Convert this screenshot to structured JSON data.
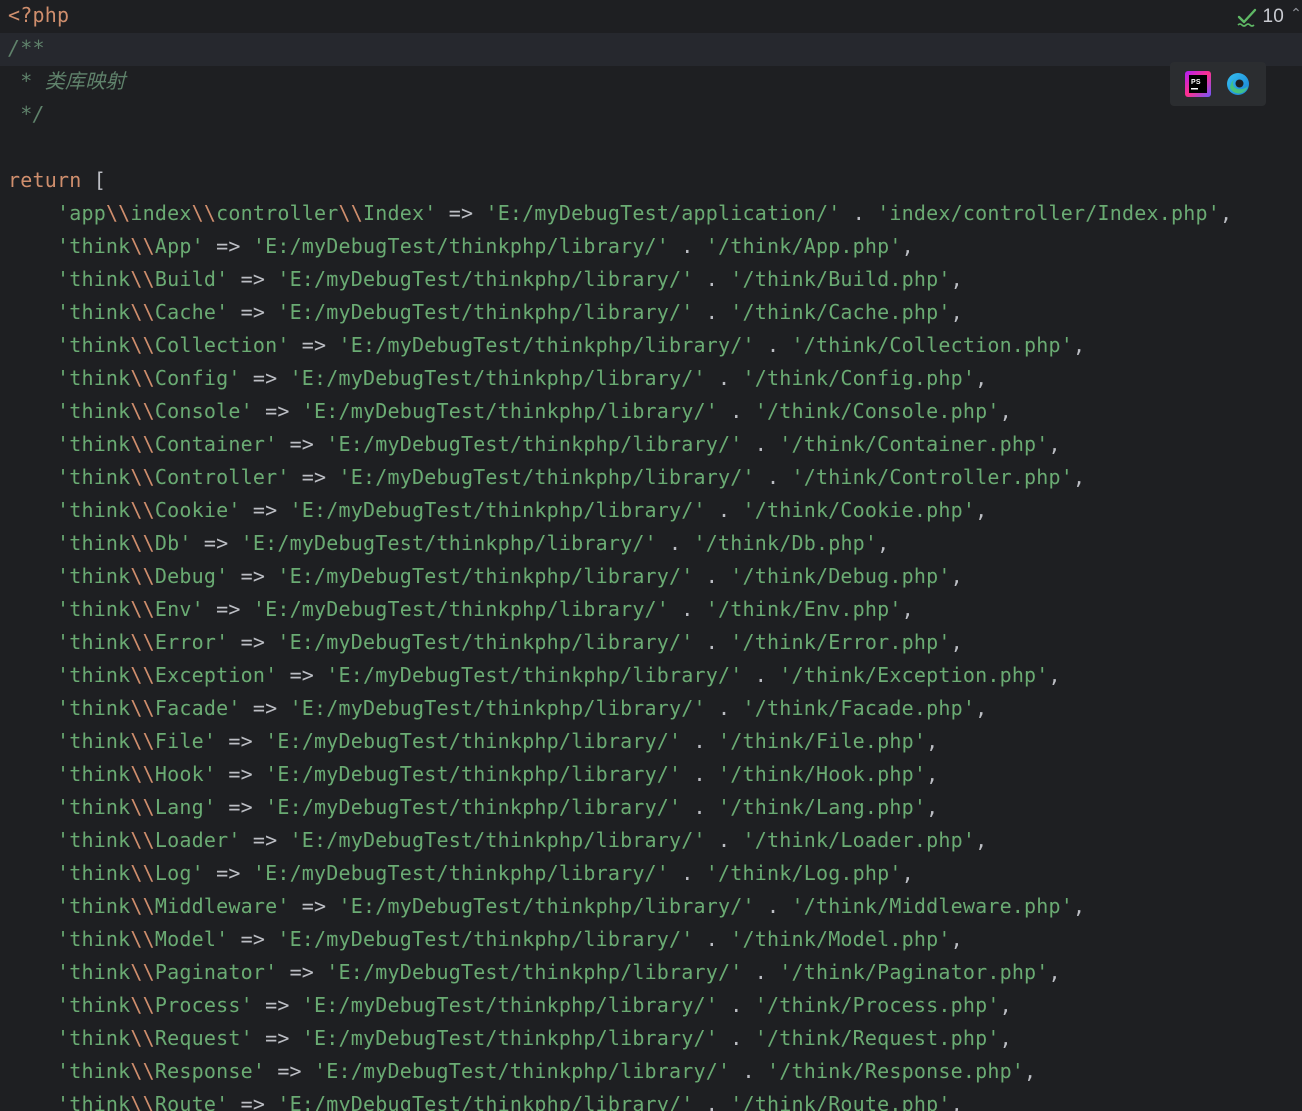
{
  "editor": {
    "header_lines": [
      {
        "type": "tag",
        "text": "<?php"
      },
      {
        "type": "doc",
        "text": "/**",
        "highlight": true
      },
      {
        "type": "doc",
        "text": " * 类库映射"
      },
      {
        "type": "doc",
        "text": " */"
      },
      {
        "type": "blank",
        "text": ""
      },
      {
        "type": "return",
        "keyword": "return",
        "bracket": " ["
      }
    ],
    "entries": [
      {
        "key": "'app\\\\index\\\\controller\\\\Index'",
        "base": "'E:/myDebugTest/application/'",
        "file": "'index/controller/Index.php'"
      },
      {
        "key": "'think\\\\App'",
        "base": "'E:/myDebugTest/thinkphp/library/'",
        "file": "'/think/App.php'"
      },
      {
        "key": "'think\\\\Build'",
        "base": "'E:/myDebugTest/thinkphp/library/'",
        "file": "'/think/Build.php'"
      },
      {
        "key": "'think\\\\Cache'",
        "base": "'E:/myDebugTest/thinkphp/library/'",
        "file": "'/think/Cache.php'"
      },
      {
        "key": "'think\\\\Collection'",
        "base": "'E:/myDebugTest/thinkphp/library/'",
        "file": "'/think/Collection.php'"
      },
      {
        "key": "'think\\\\Config'",
        "base": "'E:/myDebugTest/thinkphp/library/'",
        "file": "'/think/Config.php'"
      },
      {
        "key": "'think\\\\Console'",
        "base": "'E:/myDebugTest/thinkphp/library/'",
        "file": "'/think/Console.php'"
      },
      {
        "key": "'think\\\\Container'",
        "base": "'E:/myDebugTest/thinkphp/library/'",
        "file": "'/think/Container.php'"
      },
      {
        "key": "'think\\\\Controller'",
        "base": "'E:/myDebugTest/thinkphp/library/'",
        "file": "'/think/Controller.php'"
      },
      {
        "key": "'think\\\\Cookie'",
        "base": "'E:/myDebugTest/thinkphp/library/'",
        "file": "'/think/Cookie.php'"
      },
      {
        "key": "'think\\\\Db'",
        "base": "'E:/myDebugTest/thinkphp/library/'",
        "file": "'/think/Db.php'"
      },
      {
        "key": "'think\\\\Debug'",
        "base": "'E:/myDebugTest/thinkphp/library/'",
        "file": "'/think/Debug.php'"
      },
      {
        "key": "'think\\\\Env'",
        "base": "'E:/myDebugTest/thinkphp/library/'",
        "file": "'/think/Env.php'"
      },
      {
        "key": "'think\\\\Error'",
        "base": "'E:/myDebugTest/thinkphp/library/'",
        "file": "'/think/Error.php'"
      },
      {
        "key": "'think\\\\Exception'",
        "base": "'E:/myDebugTest/thinkphp/library/'",
        "file": "'/think/Exception.php'"
      },
      {
        "key": "'think\\\\Facade'",
        "base": "'E:/myDebugTest/thinkphp/library/'",
        "file": "'/think/Facade.php'"
      },
      {
        "key": "'think\\\\File'",
        "base": "'E:/myDebugTest/thinkphp/library/'",
        "file": "'/think/File.php'"
      },
      {
        "key": "'think\\\\Hook'",
        "base": "'E:/myDebugTest/thinkphp/library/'",
        "file": "'/think/Hook.php'"
      },
      {
        "key": "'think\\\\Lang'",
        "base": "'E:/myDebugTest/thinkphp/library/'",
        "file": "'/think/Lang.php'"
      },
      {
        "key": "'think\\\\Loader'",
        "base": "'E:/myDebugTest/thinkphp/library/'",
        "file": "'/think/Loader.php'"
      },
      {
        "key": "'think\\\\Log'",
        "base": "'E:/myDebugTest/thinkphp/library/'",
        "file": "'/think/Log.php'"
      },
      {
        "key": "'think\\\\Middleware'",
        "base": "'E:/myDebugTest/thinkphp/library/'",
        "file": "'/think/Middleware.php'"
      },
      {
        "key": "'think\\\\Model'",
        "base": "'E:/myDebugTest/thinkphp/library/'",
        "file": "'/think/Model.php'"
      },
      {
        "key": "'think\\\\Paginator'",
        "base": "'E:/myDebugTest/thinkphp/library/'",
        "file": "'/think/Paginator.php'"
      },
      {
        "key": "'think\\\\Process'",
        "base": "'E:/myDebugTest/thinkphp/library/'",
        "file": "'/think/Process.php'"
      },
      {
        "key": "'think\\\\Request'",
        "base": "'E:/myDebugTest/thinkphp/library/'",
        "file": "'/think/Request.php'"
      },
      {
        "key": "'think\\\\Response'",
        "base": "'E:/myDebugTest/thinkphp/library/'",
        "file": "'/think/Response.php'"
      },
      {
        "key": "'think\\\\Route'",
        "base": "'E:/myDebugTest/thinkphp/library/'",
        "file": "'/think/Route.php'"
      }
    ],
    "operators": {
      "arrow": "=>",
      "concat": ".",
      "comma": ","
    },
    "indent": "    "
  },
  "inspection": {
    "count": "10",
    "icon": "check-icon",
    "color": "#5fb865"
  },
  "browser_icons": [
    {
      "name": "phpstorm-icon",
      "label": "PS"
    },
    {
      "name": "edge-icon",
      "label": ""
    }
  ],
  "colors": {
    "background": "#1e1f22",
    "keyword": "#cf8e6d",
    "string": "#6aab73",
    "doc_comment": "#5f826b",
    "operator": "#bcbec4"
  }
}
